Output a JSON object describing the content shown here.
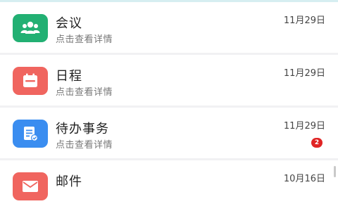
{
  "colors": {
    "meeting": "#22b073",
    "schedule": "#f0655f",
    "todo": "#3a8df0",
    "mail": "#f0655f",
    "badge": "#e02424"
  },
  "items": [
    {
      "title": "会议",
      "subtitle": "点击查看详情",
      "date": "11月29日",
      "icon": "people-group-icon"
    },
    {
      "title": "日程",
      "subtitle": "点击查看详情",
      "date": "11月29日",
      "icon": "calendar-icon"
    },
    {
      "title": "待办事务",
      "subtitle": "点击查看详情",
      "date": "11月29日",
      "icon": "document-check-icon",
      "badge": "2"
    },
    {
      "title": "邮件",
      "subtitle": "",
      "date": "10月16日",
      "icon": "mail-icon"
    }
  ]
}
